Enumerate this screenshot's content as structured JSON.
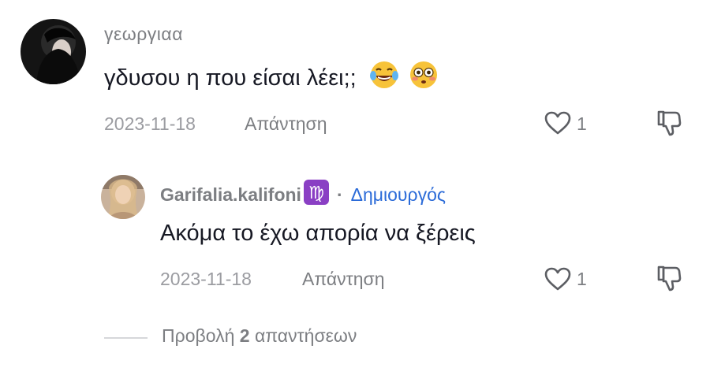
{
  "comments": [
    {
      "username": "γεωργιαα",
      "text": "γδυσου η που είσαι λέει;;",
      "emoji": [
        "face-with-tears-of-joy-icon",
        "flushed-face-icon"
      ],
      "date": "2023-11-18",
      "reply_label": "Απάντηση",
      "likes": "1"
    }
  ],
  "reply": {
    "username": "Garifalia.kalifoni",
    "badge_icon": "virgo-sign-icon",
    "separator": "·",
    "role": "Δημιουργός",
    "text": "Ακόμα το έχω απορία να ξέρεις",
    "date": "2023-11-18",
    "reply_label": "Απάντηση",
    "likes": "1"
  },
  "view_replies": {
    "prefix": "Προβολή",
    "count": "2",
    "suffix": "απαντήσεων"
  },
  "colors": {
    "creator": "#2b6bd8",
    "secondary_text": "#7c7e82",
    "badge": "#8a3fc4"
  }
}
